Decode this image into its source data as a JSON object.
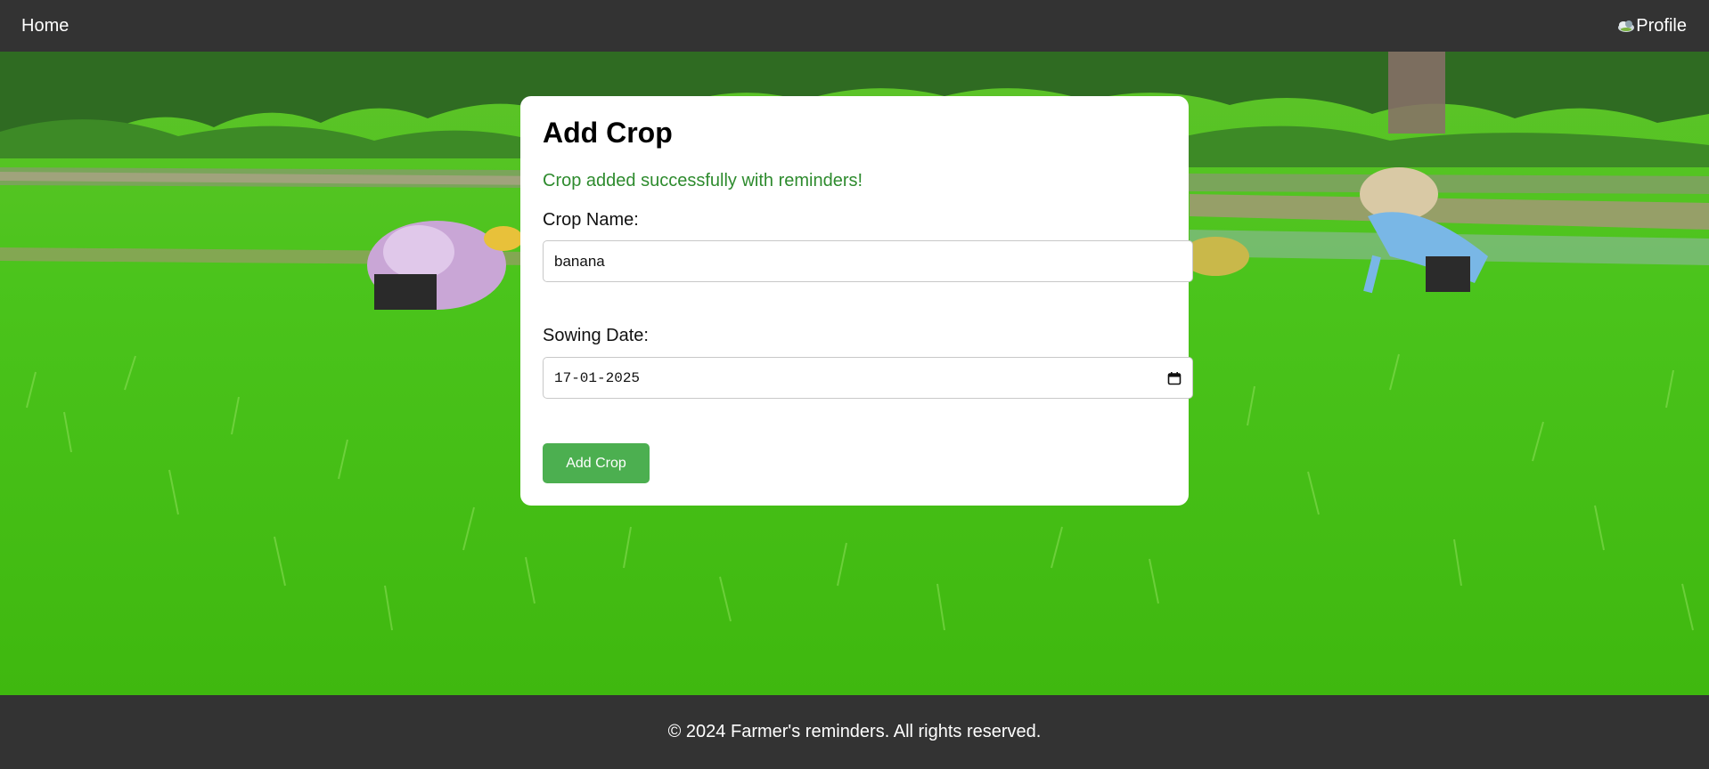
{
  "nav": {
    "home_label": "Home",
    "profile_label": "Profile",
    "profile_icon": "cloud-avatar-icon"
  },
  "form": {
    "title": "Add Crop",
    "success_message": "Crop added successfully with reminders!",
    "crop_name_label": "Crop Name:",
    "crop_name_value": "banana",
    "sowing_date_label": "Sowing Date:",
    "sowing_date_value": "17-01-2025",
    "submit_label": "Add Crop"
  },
  "footer": {
    "text": "© 2024 Farmer's reminders. All rights reserved."
  },
  "colors": {
    "nav_bg": "#333333",
    "button": "#4caf50",
    "success": "#2e8b2e"
  }
}
